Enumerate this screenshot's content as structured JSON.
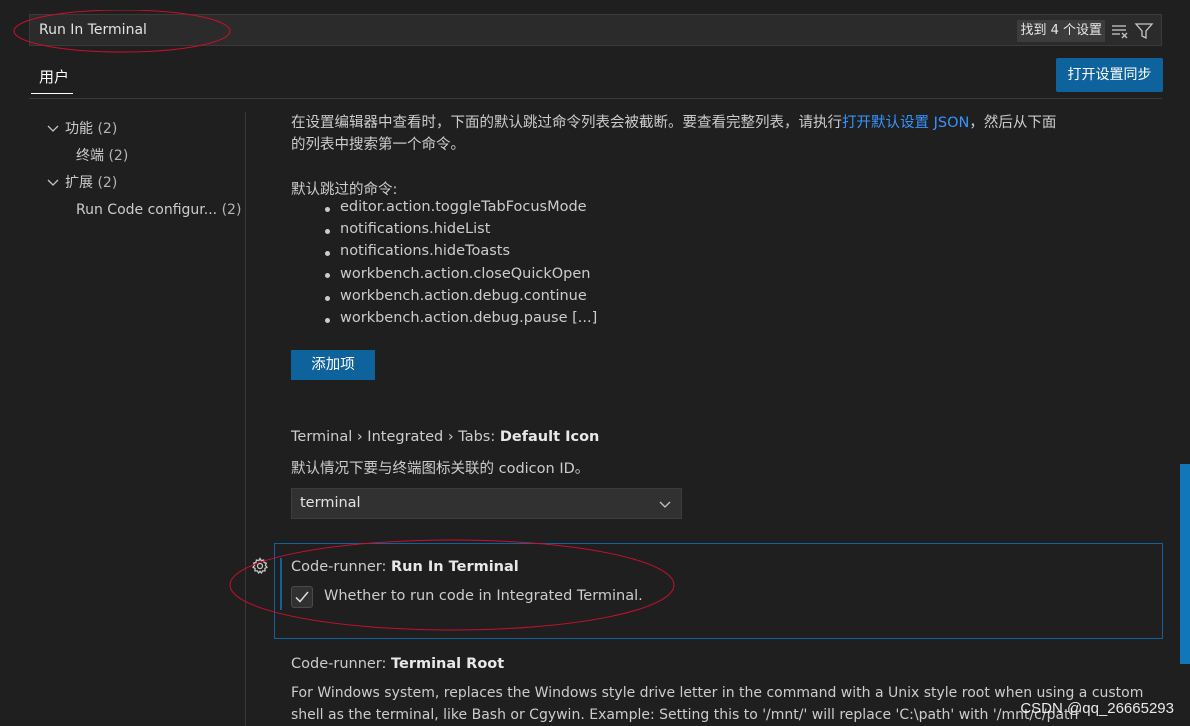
{
  "search": {
    "value": "Run In Terminal",
    "result_count": "找到 4 个设置",
    "clear_filter_icon": "clear-filter-icon",
    "filter_icon": "filter-icon"
  },
  "tabs": {
    "user": "用户",
    "sync_button": "打开设置同步"
  },
  "toc": [
    {
      "label": "功能",
      "count": "(2)",
      "expanded": true
    },
    {
      "label": "终端",
      "count": "(2)"
    },
    {
      "label": "扩展",
      "count": "(2)",
      "expanded": true
    },
    {
      "label": "Run Code configur...",
      "count": "(2)"
    }
  ],
  "settings": {
    "skip_commands": {
      "desc_part1": "在设置编辑器中查看时，下面的默认跳过命令列表会被截断。要查看完整列表，请执行",
      "desc_link": "打开默认设置 JSON",
      "desc_part2": "，然后从下面",
      "desc_line2": "的列表中搜索第一个命令。",
      "default_label": "默认跳过的命令:",
      "commands": [
        "editor.action.toggleTabFocusMode",
        "notifications.hideList",
        "notifications.hideToasts",
        "workbench.action.closeQuickOpen",
        "workbench.action.debug.continue",
        "workbench.action.debug.pause [...]"
      ],
      "add_button": "添加项"
    },
    "default_icon": {
      "category": "Terminal › Integrated › Tabs: ",
      "name": "Default Icon",
      "description": "默认情况下要与终端图标关联的 codicon ID。",
      "value": "terminal"
    },
    "run_in_terminal": {
      "category": "Code-runner: ",
      "name": "Run In Terminal",
      "checkbox_label": "Whether to run code in Integrated Terminal.",
      "checked": true
    },
    "terminal_root": {
      "category": "Code-runner: ",
      "name": "Terminal Root",
      "desc_line1": "For Windows system, replaces the Windows style drive letter in the command with a Unix style root when using a custom",
      "desc_line2": "shell as the terminal, like Bash or Cgywin. Example: Setting this to '/mnt/' will replace 'C:\\path' with '/mnt/c/path'"
    }
  },
  "watermark": "CSDN @qq_26665293",
  "colors": {
    "accent": "#0e639c",
    "link": "#3794ff",
    "annotation": "#c8102e",
    "background": "#1f1f1f"
  }
}
